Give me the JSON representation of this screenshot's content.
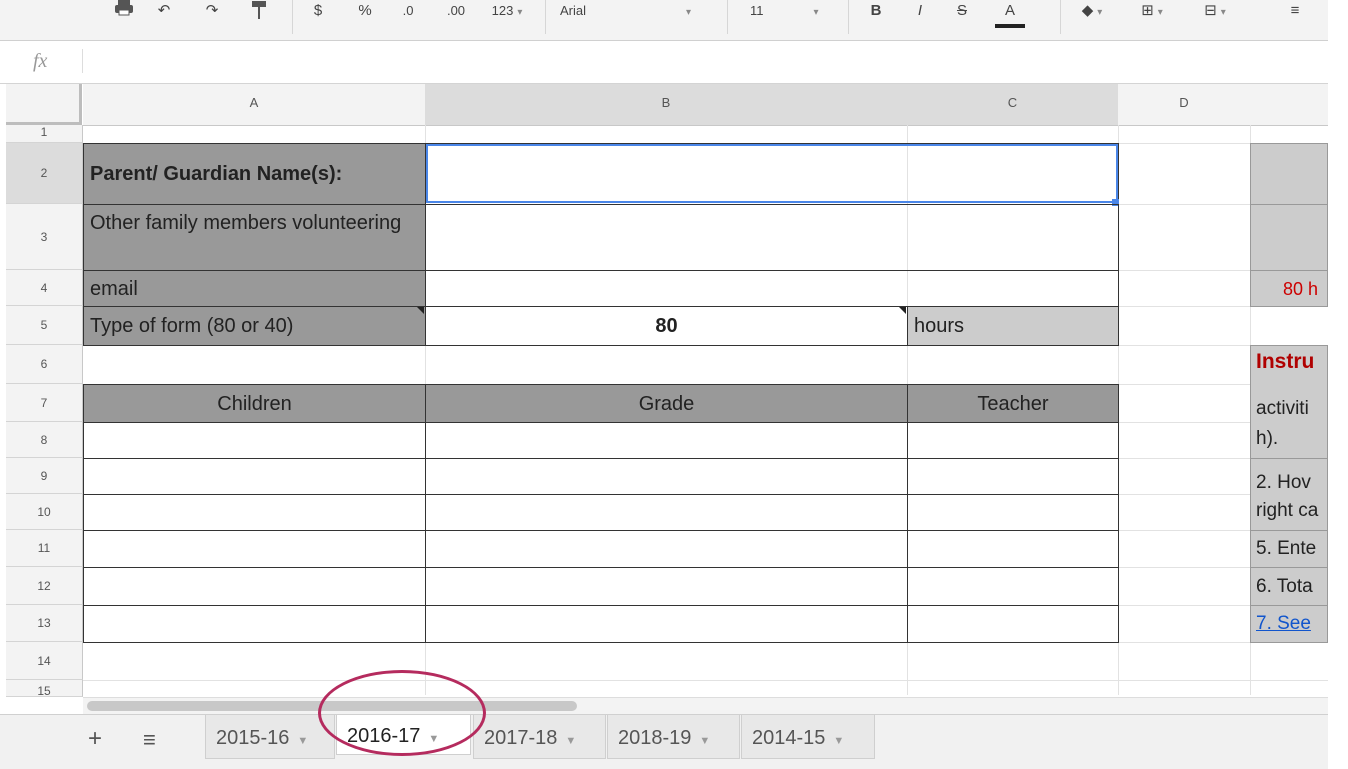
{
  "toolbar": {
    "currency": "$",
    "percent": "%",
    "dec_less": ".0",
    "dec_more": ".00",
    "format": "123",
    "font": "Arial",
    "size": "11",
    "bold": "B",
    "italic": "I",
    "strike": "S",
    "text_color": "A"
  },
  "formula_bar": {
    "fx": "fx",
    "value": ""
  },
  "columns": [
    "A",
    "B",
    "C",
    "D"
  ],
  "rows": [
    "1",
    "2",
    "3",
    "4",
    "5",
    "6",
    "7",
    "8",
    "9",
    "10",
    "11",
    "12",
    "13",
    "14",
    "15"
  ],
  "form": {
    "parent_label": "Parent/ Guardian Name(s):",
    "parent_value": "",
    "family_label": "Other family members volunteering",
    "family_value": "",
    "email_label": "email",
    "email_value": "",
    "type_label": "Type of form (80 or 40)",
    "type_value": "80",
    "type_unit": "hours"
  },
  "table": {
    "headers": [
      "Children",
      "Grade",
      "Teacher"
    ]
  },
  "right_panel": {
    "red_text": "80 h",
    "heading": "Instru",
    "line1a": "activiti",
    "line1b": "h).",
    "line2a": "2. Hov",
    "line2b": "right ca",
    "line5": "5. Ente",
    "line6": "6. Tota",
    "line7": "7. See"
  },
  "tabs": [
    {
      "label": "2015-16",
      "active": false
    },
    {
      "label": "2016-17",
      "active": true
    },
    {
      "label": "2017-18",
      "active": false
    },
    {
      "label": "2018-19",
      "active": false
    },
    {
      "label": "2014-15",
      "active": false
    }
  ],
  "colors": {
    "accent": "#4a86e8",
    "header_fill": "#999999",
    "circle": "#b52b5e",
    "red_text": "#cc0000",
    "link": "#1155cc"
  }
}
